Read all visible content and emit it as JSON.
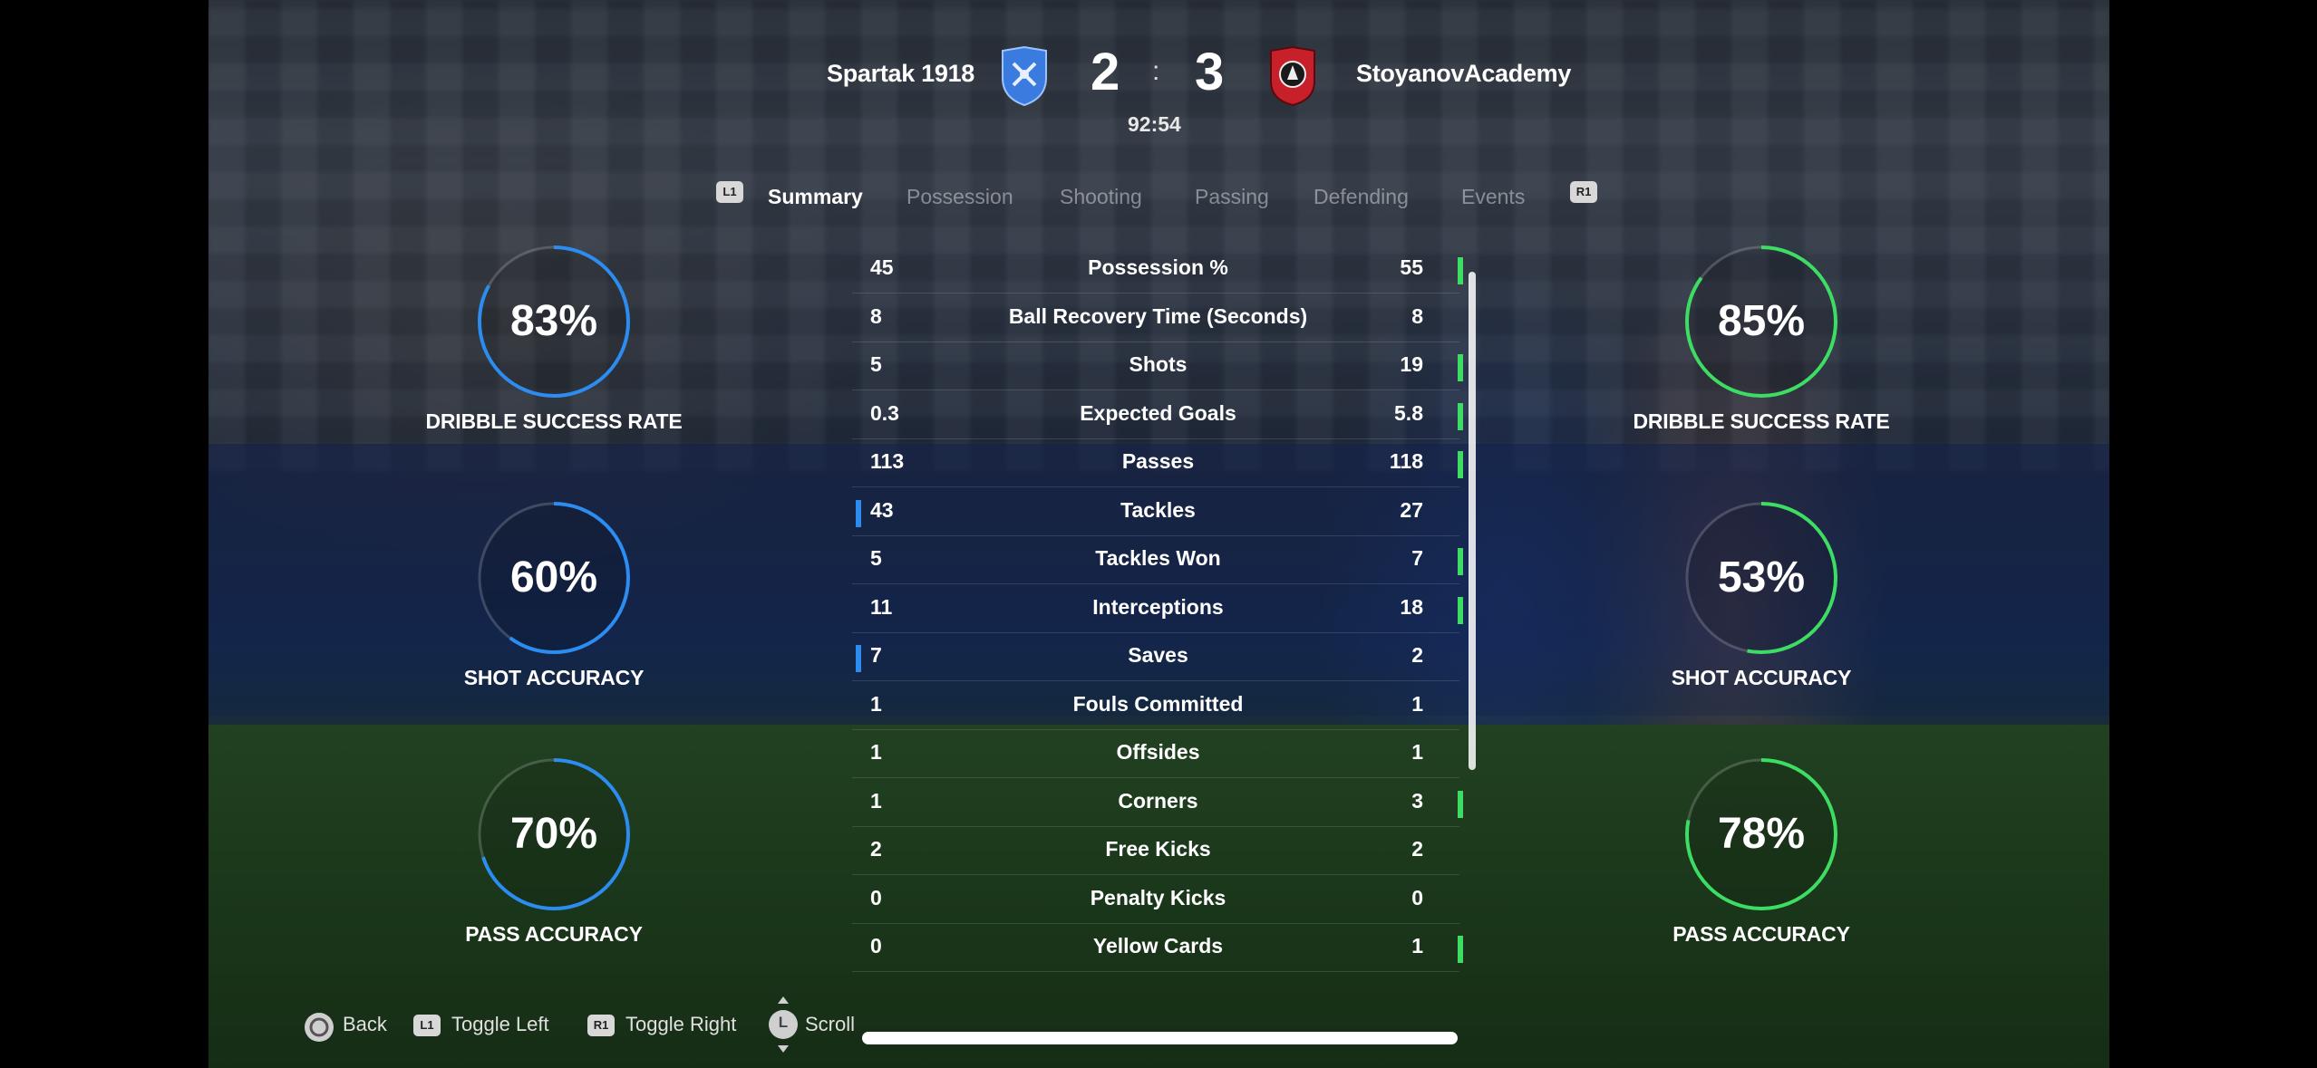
{
  "match": {
    "home_team": "Spartak 1918",
    "away_team": "StoyanovAcademy",
    "home_score": "2",
    "away_score": "3",
    "separator": ":",
    "clock": "92:54"
  },
  "colors": {
    "home": "#2d8cf0",
    "away": "#3ddc63",
    "home_crest": "#3a7be0",
    "away_crest": "#c8202a"
  },
  "tabs": {
    "left_button": "L1",
    "right_button": "R1",
    "items": [
      "Summary",
      "Possession",
      "Shooting",
      "Passing",
      "Defending",
      "Events"
    ],
    "active": "Summary"
  },
  "stats": [
    {
      "label": "Possession %",
      "home": "45",
      "away": "55",
      "lead": "away"
    },
    {
      "label": "Ball Recovery Time (Seconds)",
      "home": "8",
      "away": "8",
      "lead": "none"
    },
    {
      "label": "Shots",
      "home": "5",
      "away": "19",
      "lead": "away"
    },
    {
      "label": "Expected Goals",
      "home": "0.3",
      "away": "5.8",
      "lead": "away"
    },
    {
      "label": "Passes",
      "home": "113",
      "away": "118",
      "lead": "away"
    },
    {
      "label": "Tackles",
      "home": "43",
      "away": "27",
      "lead": "home"
    },
    {
      "label": "Tackles Won",
      "home": "5",
      "away": "7",
      "lead": "away"
    },
    {
      "label": "Interceptions",
      "home": "11",
      "away": "18",
      "lead": "away"
    },
    {
      "label": "Saves",
      "home": "7",
      "away": "2",
      "lead": "home"
    },
    {
      "label": "Fouls Committed",
      "home": "1",
      "away": "1",
      "lead": "none"
    },
    {
      "label": "Offsides",
      "home": "1",
      "away": "1",
      "lead": "none"
    },
    {
      "label": "Corners",
      "home": "1",
      "away": "3",
      "lead": "away"
    },
    {
      "label": "Free Kicks",
      "home": "2",
      "away": "2",
      "lead": "none"
    },
    {
      "label": "Penalty Kicks",
      "home": "0",
      "away": "0",
      "lead": "none"
    },
    {
      "label": "Yellow Cards",
      "home": "0",
      "away": "1",
      "lead": "away"
    }
  ],
  "rings": {
    "home": [
      {
        "label": "DRIBBLE SUCCESS RATE",
        "value": "83%",
        "fraction": 0.83
      },
      {
        "label": "SHOT ACCURACY",
        "value": "60%",
        "fraction": 0.6
      },
      {
        "label": "PASS ACCURACY",
        "value": "70%",
        "fraction": 0.7
      }
    ],
    "away": [
      {
        "label": "DRIBBLE SUCCESS RATE",
        "value": "85%",
        "fraction": 0.85
      },
      {
        "label": "SHOT ACCURACY",
        "value": "53%",
        "fraction": 0.53
      },
      {
        "label": "PASS ACCURACY",
        "value": "78%",
        "fraction": 0.78
      }
    ]
  },
  "hints": {
    "back": "Back",
    "toggle_left_btn": "L1",
    "toggle_left": "Toggle Left",
    "toggle_right_btn": "R1",
    "toggle_right": "Toggle Right",
    "scroll_btn": "L",
    "scroll": "Scroll"
  }
}
